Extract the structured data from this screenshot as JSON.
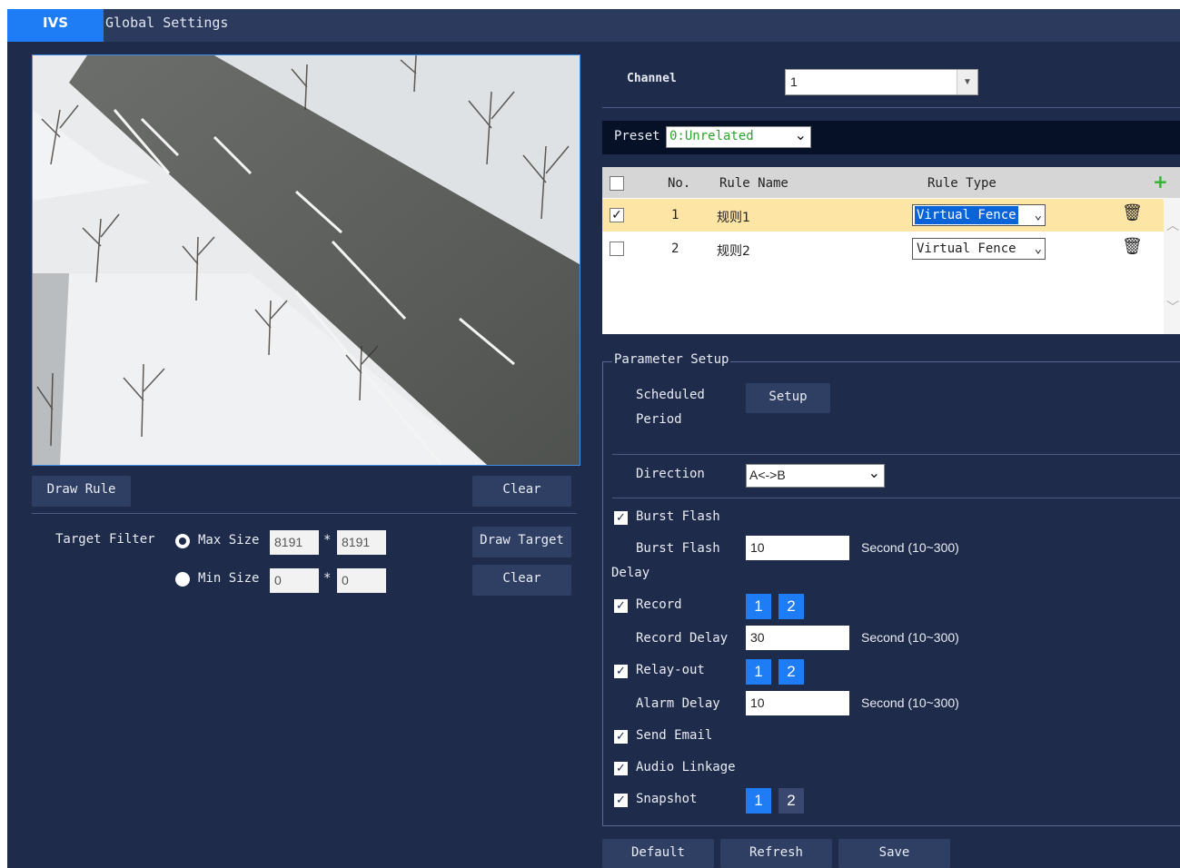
{
  "tabs": {
    "ivs": "IVS",
    "global": "Global Settings"
  },
  "left": {
    "draw_rule": "Draw Rule",
    "clear_rule": "Clear",
    "target_filter_label": "Target Filter",
    "max_size_label": "Max Size",
    "max_w": "8191",
    "max_h": "8191",
    "min_size_label": "Min Size",
    "min_w": "0",
    "min_h": "0",
    "times": "*",
    "draw_target": "Draw Target",
    "clear_target": "Clear"
  },
  "channel": {
    "label": "Channel",
    "value": "1"
  },
  "preset": {
    "label": "Preset",
    "value": "0:Unrelated"
  },
  "table": {
    "headers": {
      "no": "No.",
      "name": "Rule Name",
      "type": "Rule Type"
    },
    "rows": [
      {
        "no": "1",
        "name": "规则1",
        "type": "Virtual Fence",
        "checked": true
      },
      {
        "no": "2",
        "name": "规则2",
        "type": "Virtual Fence",
        "checked": false
      }
    ]
  },
  "params": {
    "title": "Parameter Setup",
    "scheduled_period": "Scheduled",
    "scheduled_period_2": "Period",
    "setup_btn": "Setup",
    "direction_label": "Direction",
    "direction_value": "A<->B",
    "burst_flash": "Burst Flash",
    "burst_flash_delay": "Burst Flash",
    "burst_flash_delay_2": "Delay",
    "burst_flash_delay_value": "10",
    "second_range": "Second (10~300)",
    "record": "Record",
    "record_delay": "Record Delay",
    "record_delay_value": "30",
    "relay_out": "Relay-out",
    "alarm_delay": "Alarm Delay",
    "alarm_delay_value": "10",
    "send_email": "Send Email",
    "audio_linkage": "Audio Linkage",
    "snapshot": "Snapshot",
    "ch1": "1",
    "ch2": "2"
  },
  "footer": {
    "default": "Default",
    "refresh": "Refresh",
    "save": "Save"
  },
  "colors": {
    "bg": "#1f2b4a",
    "accent": "#1e7cf5",
    "button": "#2f3e63",
    "highlight_row": "#fde5a6"
  },
  "icons": {
    "add": "plus-icon",
    "delete": "trash-icon",
    "dropdown": "chevron-down-icon",
    "check": "check-icon"
  }
}
